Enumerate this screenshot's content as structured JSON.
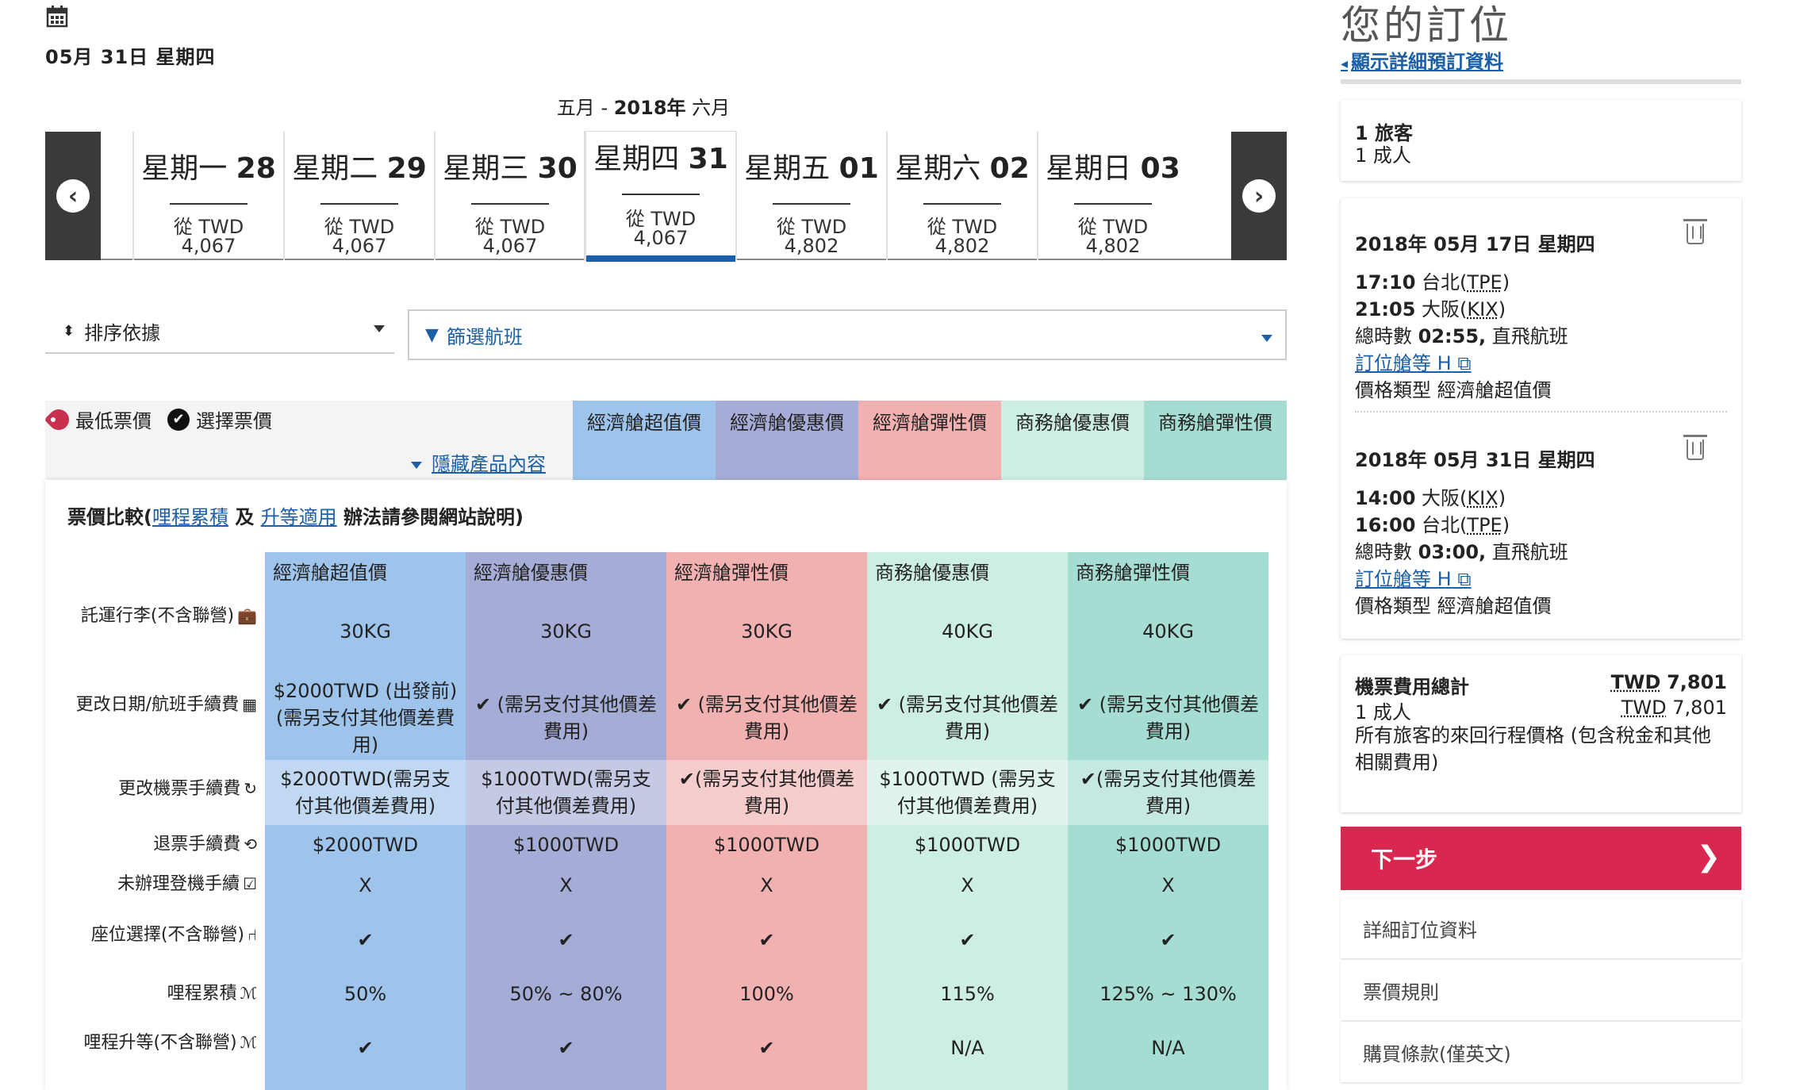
{
  "header": {
    "calendar_icon": "calendar-icon",
    "selected_date": "05月 31日 星期四",
    "month_range_pre": "五月 - ",
    "month_range_year": "2018年",
    "month_range_post": " 六月"
  },
  "carousel": {
    "prev_icon": "arrow-left-icon",
    "next_icon": "arrow-right-icon",
    "days": [
      {
        "weekday": "星期一",
        "num": "28",
        "from": "從 TWD",
        "price": "4,067",
        "selected": false
      },
      {
        "weekday": "星期二",
        "num": "29",
        "from": "從 TWD",
        "price": "4,067",
        "selected": false
      },
      {
        "weekday": "星期三",
        "num": "30",
        "from": "從 TWD",
        "price": "4,067",
        "selected": false
      },
      {
        "weekday": "星期四",
        "num": "31",
        "from": "從 TWD",
        "price": "4,067",
        "selected": true
      },
      {
        "weekday": "星期五",
        "num": "01",
        "from": "從 TWD",
        "price": "4,802",
        "selected": false
      },
      {
        "weekday": "星期六",
        "num": "02",
        "from": "從 TWD",
        "price": "4,802",
        "selected": false
      },
      {
        "weekday": "星期日",
        "num": "03",
        "from": "從 TWD",
        "price": "4,802",
        "selected": false
      }
    ]
  },
  "controls": {
    "sort_label": "排序依據",
    "filter_label": "篩選航班"
  },
  "legend": {
    "lowest": "最低票價",
    "chosen": "選擇票價",
    "hide_link": "隱藏產品內容"
  },
  "fare_classes": [
    {
      "name": "經濟艙超值價",
      "color": "#9ec4ec"
    },
    {
      "name": "經濟艙優惠價",
      "color": "#a5add6"
    },
    {
      "name": "經濟艙彈性價",
      "color": "#f2b1b1"
    },
    {
      "name": "商務艙優惠價",
      "color": "#cdeee4"
    },
    {
      "name": "商務艙彈性價",
      "color": "#a6ddd3"
    }
  ],
  "comparison": {
    "title_pre": "票價比較(",
    "link1": "哩程累積",
    "mid": " 及 ",
    "link2": "升等適用",
    "title_post": " 辦法請參閱網站說明)",
    "rows": [
      {
        "label": "託運行李(不含聯營)",
        "icon": "suitcase-icon",
        "values": [
          "30KG",
          "30KG",
          "30KG",
          "40KG",
          "40KG"
        ]
      },
      {
        "label": "更改日期/航班手續費",
        "icon": "calendar-icon",
        "values": [
          "$2000TWD (出發前) (需另支付其他價差費用)",
          "✔ (需另支付其他價差費用)",
          "✔ (需另支付其他價差費用)",
          "✔ (需另支付其他價差費用)",
          "✔ (需另支付其他價差費用)"
        ]
      },
      {
        "label": "更改機票手續費",
        "icon": "refresh-icon",
        "values": [
          "$2000TWD(需另支付其他價差費用)",
          "$1000TWD(需另支付其他價差費用)",
          "✔(需另支付其他價差費用)",
          "$1000TWD (需另支付其他價差費用)",
          "✔(需另支付其他價差費用)"
        ]
      },
      {
        "label": "退票手續費",
        "icon": "refund-icon",
        "values": [
          "$2000TWD",
          "$1000TWD",
          "$1000TWD",
          "$1000TWD",
          "$1000TWD"
        ]
      },
      {
        "label": "未辦理登機手續",
        "icon": "checkbox-icon",
        "values": [
          "X",
          "X",
          "X",
          "X",
          "X"
        ]
      },
      {
        "label": "座位選擇(不含聯營)",
        "icon": "seat-icon",
        "values": [
          "✔",
          "✔",
          "✔",
          "✔",
          "✔"
        ]
      },
      {
        "label": "哩程累積",
        "icon": "miles-icon",
        "values": [
          "50%",
          "50% ~ 80%",
          "100%",
          "115%",
          "125% ~ 130%"
        ]
      },
      {
        "label": "哩程升等(不含聯營)",
        "icon": "miles-icon",
        "values": [
          "✔",
          "✔",
          "✔",
          "N/A",
          "N/A"
        ]
      }
    ]
  },
  "sidebar": {
    "title": "您的訂位",
    "detail_link": "顯示詳細預訂資料",
    "passengers_count": "1 旅客",
    "passengers_type": "1 成人",
    "flights": [
      {
        "date": "2018年 05月 17日 星期四",
        "dep_time": "17:10",
        "dep_city": "台北(",
        "dep_code": "TPE",
        "arr_time": "21:05",
        "arr_city": "大阪(",
        "arr_code": "KIX",
        "duration_pre": "總時數 ",
        "duration": "02:55,",
        "duration_post": " 直飛航班",
        "class_link": "訂位艙等 H",
        "fare_type": "價格類型 經濟艙超值價"
      },
      {
        "date": "2018年 05月 31日 星期四",
        "dep_time": "14:00",
        "dep_city": "大阪(",
        "dep_code": "KIX",
        "arr_time": "16:00",
        "arr_city": "台北(",
        "arr_code": "TPE",
        "duration_pre": "總時數 ",
        "duration": "03:00,",
        "duration_post": " 直飛航班",
        "class_link": "訂位艙等 H",
        "fare_type": "價格類型 經濟艙超值價"
      }
    ],
    "total_label": "機票費用總計",
    "total_cur": "TWD",
    "total_value": "7,801",
    "adult_label": "1 成人",
    "adult_cur": "TWD",
    "adult_value": "7,801",
    "total_note": "所有旅客的來回行程價格 (包含稅金和其他相關費用)",
    "next_button": "下一步",
    "links": [
      "詳細訂位資料",
      "票價規則",
      "購買條款(僅英文)"
    ]
  }
}
